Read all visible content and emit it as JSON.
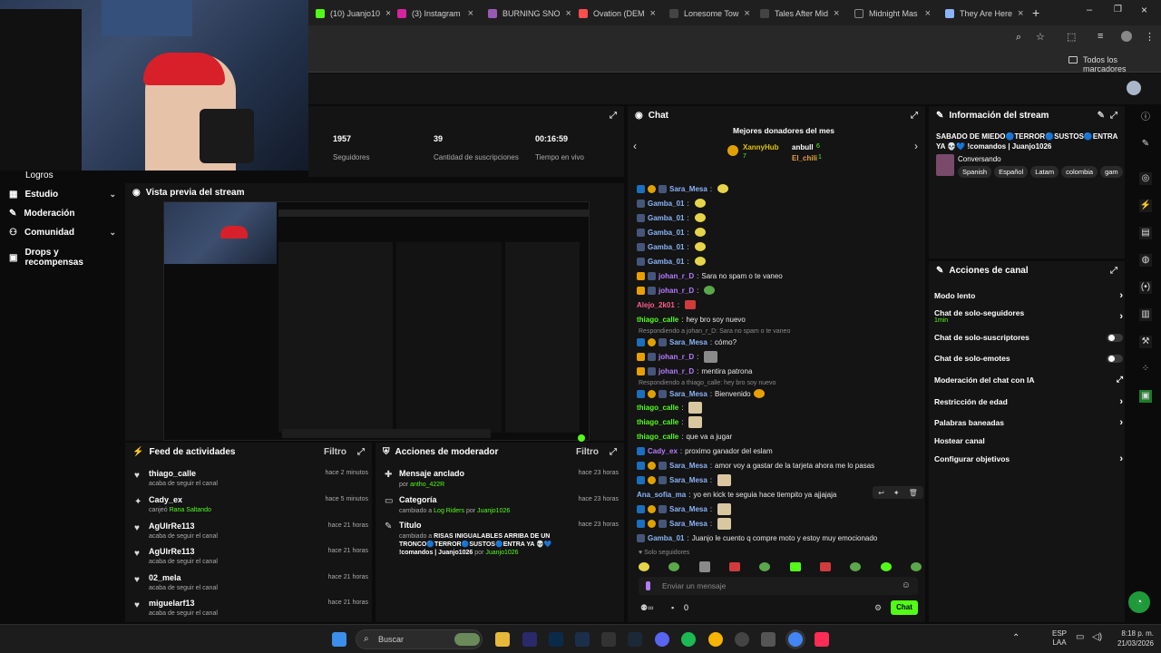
{
  "browser": {
    "tabs": [
      {
        "label": "(10) Juanjo10",
        "color": "#53fc18"
      },
      {
        "label": "(3) Instagram",
        "color": "#d6249f"
      },
      {
        "label": "BURNING SNO",
        "color": "#9b59b6"
      },
      {
        "label": "Ovation (DEM",
        "color": "#ff4d4d"
      },
      {
        "label": "Lonesome Tow",
        "color": "#ffffff"
      },
      {
        "label": "Tales After Mid",
        "color": "#ffffff"
      },
      {
        "label": "Midnight Mas",
        "color": "#ffffff"
      },
      {
        "label": "They Are Here",
        "color": "#8ab4f8"
      }
    ],
    "bookmarks_label": "Todos los marcadores"
  },
  "stats": [
    {
      "value": "1957",
      "label": "Seguidores"
    },
    {
      "value": "39",
      "label": "Cantidad de suscripciones"
    },
    {
      "value": "00:16:59",
      "label": "Tiempo en vivo"
    }
  ],
  "sidebar": {
    "items": [
      {
        "label": "Logros"
      },
      {
        "label": "Estudio"
      },
      {
        "label": "Moderación"
      },
      {
        "label": "Comunidad"
      },
      {
        "label": "Drops y recompensas"
      }
    ]
  },
  "preview": {
    "title": "Vista previa del stream"
  },
  "feed": {
    "title": "Feed de actividades",
    "filter": "Filtro",
    "items": [
      {
        "name": "thiago_calle",
        "sub": "acaba de seguir el canal",
        "time": "hace 2 minutos"
      },
      {
        "name": "Cady_ex",
        "sub_pre": "canjeó",
        "sub_hl": "Rana Saltando",
        "time": "hace 5 minutos"
      },
      {
        "name": "AgUlrRe113",
        "sub": "acaba de seguir el canal",
        "time": "hace 21 horas"
      },
      {
        "name": "AgUlrRe113",
        "sub": "acaba de seguir el canal",
        "time": "hace 21 horas"
      },
      {
        "name": "02_mela",
        "sub": "acaba de seguir el canal",
        "time": "hace 21 horas"
      },
      {
        "name": "miguelarf13",
        "sub": "acaba de seguir el canal",
        "time": "hace 21 horas"
      }
    ]
  },
  "mod_actions": {
    "title": "Acciones de moderador",
    "filter": "Filtro",
    "items": [
      {
        "name": "Mensaje anclado",
        "by": "por",
        "who": "antho_422R",
        "time": "hace 23 horas"
      },
      {
        "name": "Categoría",
        "pre": "cambiado a",
        "what": "Log Riders",
        "by": "por",
        "who": "Juanjo1026",
        "time": "hace 23 horas"
      },
      {
        "name": "Título",
        "pre": "cambiado a",
        "what": "RISAS INIGUALABLES ARRIBA DE UN TRONCO🔵TERROR🔵SUSTOS🔵ENTRA YA 💀💙 !comandos | Juanjo1026",
        "by": "por",
        "who": "Juanjo1026",
        "time": "hace 23 horas"
      }
    ]
  },
  "chat": {
    "title": "Chat",
    "donors_title": "Mejores donadores del mes",
    "donors": [
      {
        "name": "XannyHub",
        "count": "7"
      },
      {
        "name": "anbull",
        "count": "6"
      },
      {
        "name": "El_chili",
        "count": "1"
      }
    ],
    "messages": [
      {
        "user": "Sara_Mesa",
        "color": "#8ab4f8",
        "text": ""
      },
      {
        "user": "Gamba_01",
        "color": "#8ab4f8",
        "text": ""
      },
      {
        "user": "Gamba_01",
        "color": "#8ab4f8",
        "text": ""
      },
      {
        "user": "Gamba_01",
        "color": "#8ab4f8",
        "text": ""
      },
      {
        "user": "Gamba_01",
        "color": "#8ab4f8",
        "text": ""
      },
      {
        "user": "Gamba_01",
        "color": "#8ab4f8",
        "text": ""
      },
      {
        "user": "johan_r_D",
        "color": "#b57cff",
        "text": "Sara no spam o te vaneo"
      },
      {
        "user": "johan_r_D",
        "color": "#b57cff",
        "text": ""
      },
      {
        "user": "Alejo_2k01",
        "color": "#ff5c8a",
        "text": ""
      },
      {
        "user": "thiago_calle",
        "color": "#53fc18",
        "text": "hey bro soy nuevo"
      },
      {
        "user": "Sara_Mesa",
        "color": "#8ab4f8",
        "text": "cómo?"
      },
      {
        "user": "johan_r_D",
        "color": "#b57cff",
        "text": ""
      },
      {
        "user": "johan_r_D",
        "color": "#b57cff",
        "text": "mentira patrona"
      },
      {
        "user": "Sara_Mesa",
        "color": "#8ab4f8",
        "text": "Bienvenido"
      },
      {
        "user": "thiago_calle",
        "color": "#53fc18",
        "text": ""
      },
      {
        "user": "thiago_calle",
        "color": "#53fc18",
        "text": ""
      },
      {
        "user": "thiago_calle",
        "color": "#53fc18",
        "text": "que va a jugar"
      },
      {
        "user": "Cady_ex",
        "color": "#b57cff",
        "text": "proximo ganador del eslam"
      },
      {
        "user": "Sara_Mesa",
        "color": "#8ab4f8",
        "text": "amor voy a gastar de la tarjeta ahora me lo pasas"
      },
      {
        "user": "Sara_Mesa",
        "color": "#8ab4f8",
        "text": ""
      },
      {
        "user": "Ana_sofia_ma",
        "color": "#8ab4f8",
        "text": "yo en kick te seguia hace tiempito ya ajjajaja"
      },
      {
        "user": "Sara_Mesa",
        "color": "#8ab4f8",
        "text": ""
      },
      {
        "user": "Sara_Mesa",
        "color": "#8ab4f8",
        "text": ""
      },
      {
        "user": "Gamba_01",
        "color": "#8ab4f8",
        "text": "Juanjo le cuento q compre moto y estoy muy emocionado"
      }
    ],
    "replies": [
      "Respondiendo a johan_r_D: Sara no spam o te vaneo",
      "Respondiendo a thiago_calle: hey bro soy nuevo"
    ],
    "followers_only": "Solo seguidores",
    "input_placeholder": "Enviar un mensaje",
    "counter": "0",
    "send": "Chat"
  },
  "stream_info": {
    "title": "Información del stream",
    "stream_title": "SABADO DE MIEDO🔵TERROR🔵SUSTOS🔵ENTRA YA 💀💙 !comandos | Juanjo1026",
    "category": "Conversando",
    "tags": [
      "Spanish",
      "Español",
      "Latam",
      "colombia",
      "gam"
    ]
  },
  "channel_actions": {
    "title": "Acciones de canal",
    "items": [
      {
        "label": "Modo lento"
      },
      {
        "label": "Chat de solo-seguidores",
        "sub": "1min"
      },
      {
        "label": "Chat de solo-suscriptores"
      },
      {
        "label": "Chat de solo-emotes"
      },
      {
        "label": "Moderación del chat con IA"
      },
      {
        "label": "Restricción de edad"
      },
      {
        "label": "Palabras baneadas"
      },
      {
        "label": "Hostear canal"
      },
      {
        "label": "Configurar objetivos"
      }
    ]
  },
  "taskbar": {
    "search": "Buscar",
    "lang": "ESP",
    "lang2": "LAA",
    "time": "8:18 p. m.",
    "date": "21/03/2026"
  },
  "colors": {
    "accent": "#53fc18",
    "panel": "#141414",
    "bg": "#0b0b0b"
  }
}
